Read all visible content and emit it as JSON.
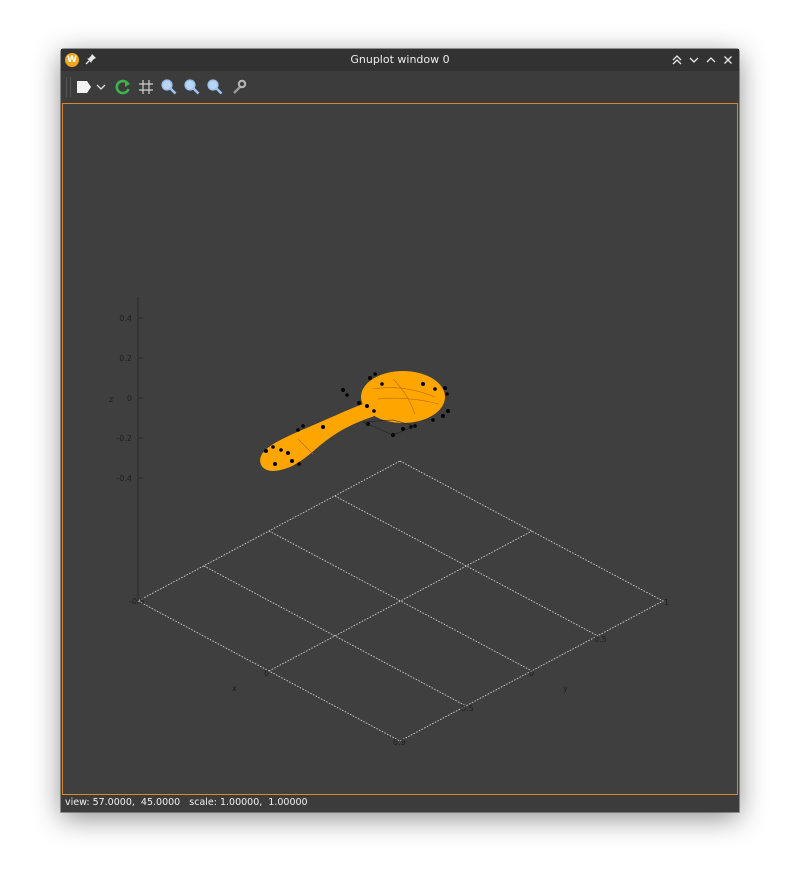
{
  "window": {
    "title": "Gnuplot window 0",
    "app_icon_letter": "W"
  },
  "toolbar": {
    "tools": [
      "export-icon",
      "dropdown-chevron-icon",
      "replot-icon",
      "grid-icon",
      "zoom-icon",
      "zoom-previous-icon",
      "zoom-next-icon",
      "settings-icon"
    ]
  },
  "plot": {
    "axis_x_label": "x",
    "axis_y_label": "y",
    "axis_z_label": "z",
    "z_ticks": [
      "0.4",
      "0.2",
      "0",
      "-0.2",
      "-0.4"
    ],
    "x_ticks": [
      "-0.5",
      "0",
      "0.5"
    ],
    "y_ticks": [
      "1",
      "0.5",
      "0"
    ],
    "corner_label": "0.9",
    "surface_color": "#ffa500",
    "point_color": "#000000",
    "frame_color": "#d58a2b"
  },
  "chart_data": {
    "type": "scatter",
    "title": "",
    "xlabel": "x",
    "ylabel": "y",
    "zlabel": "z",
    "x_ticks": [
      -0.5,
      0,
      0.5
    ],
    "y_ticks": [
      0,
      0.5,
      1
    ],
    "z_ticks": [
      -0.4,
      -0.2,
      0,
      0.2,
      0.4
    ],
    "grid": true,
    "view": [
      57.0,
      45.0
    ],
    "scale": [
      1.0,
      1.0
    ]
  },
  "status": {
    "text": "view: 57.0000,  45.0000   scale: 1.00000,  1.00000"
  }
}
